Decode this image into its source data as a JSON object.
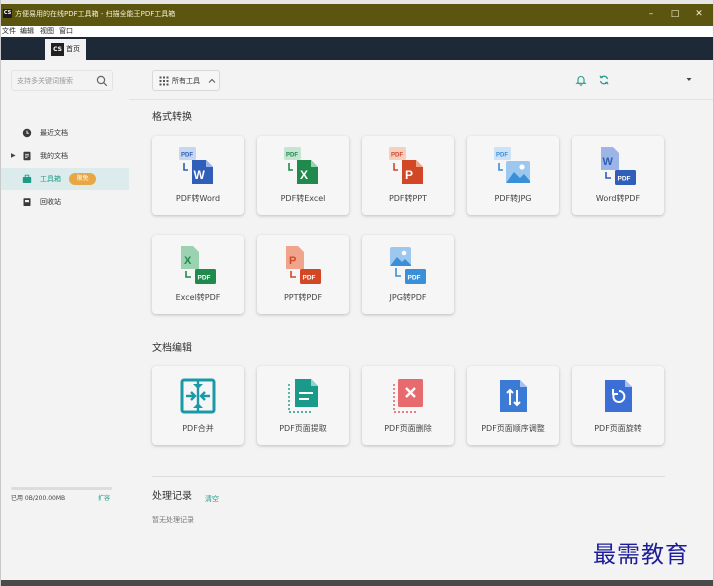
{
  "window": {
    "app_logo": "CS",
    "title": "方便易用的在线PDF工具箱 - 扫描全能王PDF工具箱",
    "controls": {
      "minimize": "–",
      "maximize": "□",
      "close": "✕"
    }
  },
  "menu": {
    "items": [
      "文件",
      "编辑",
      "视图",
      "窗口"
    ]
  },
  "tabs": {
    "home": {
      "logo": "CS",
      "label": "首页"
    }
  },
  "sidebar": {
    "search_placeholder": "支持多关键词搜索",
    "nav": [
      {
        "label": "最近文档",
        "icon": "clock-icon"
      },
      {
        "label": "我的文档",
        "icon": "document-icon",
        "collapsed_arrow": "▶"
      },
      {
        "label": "工具箱",
        "icon": "toolbox-icon",
        "badge": "限免",
        "active": true
      },
      {
        "label": "回收站",
        "icon": "trash-icon"
      }
    ],
    "storage": {
      "text": "已用 0B/200.00MB",
      "used_fraction": 0.0,
      "expand_label": "扩容"
    }
  },
  "toolbar": {
    "tools_label": "所有工具",
    "icons": [
      "bell-icon",
      "refresh-icon",
      "caret-down-icon"
    ]
  },
  "sections": {
    "convert": {
      "title": "格式转换",
      "tools": [
        {
          "label": "PDF转Word",
          "icon": "pdf-to-word-icon"
        },
        {
          "label": "PDF转Excel",
          "icon": "pdf-to-excel-icon"
        },
        {
          "label": "PDF转PPT",
          "icon": "pdf-to-ppt-icon"
        },
        {
          "label": "PDF转JPG",
          "icon": "pdf-to-jpg-icon"
        },
        {
          "label": "Word转PDF",
          "icon": "word-to-pdf-icon"
        },
        {
          "label": "Excel转PDF",
          "icon": "excel-to-pdf-icon"
        },
        {
          "label": "PPT转PDF",
          "icon": "ppt-to-pdf-icon"
        },
        {
          "label": "JPG转PDF",
          "icon": "jpg-to-pdf-icon"
        }
      ]
    },
    "edit": {
      "title": "文档编辑",
      "tools": [
        {
          "label": "PDF合并",
          "icon": "merge-icon"
        },
        {
          "label": "PDF页面提取",
          "icon": "extract-icon"
        },
        {
          "label": "PDF页面删除",
          "icon": "delete-page-icon"
        },
        {
          "label": "PDF页面顺序调整",
          "icon": "reorder-icon"
        },
        {
          "label": "PDF页面旋转",
          "icon": "rotate-icon"
        }
      ]
    }
  },
  "history": {
    "title": "处理记录",
    "clear_label": "清空",
    "empty_text": "暂无处理记录"
  },
  "watermark": "最需教育",
  "colors": {
    "title_bar": "#5b5510",
    "tab_bar": "#1e2937",
    "accent": "#1e9a8a",
    "badge": "#e8a746",
    "word": "#2f5fb8",
    "excel": "#1f8a4c",
    "ppt": "#d24726",
    "jpg": "#3a8fd8",
    "merge": "#1a9aa8",
    "extract": "#1a9a8a",
    "delete": "#e0565b",
    "reorder": "#3b7bd6",
    "rotate": "#3b6fd6"
  }
}
